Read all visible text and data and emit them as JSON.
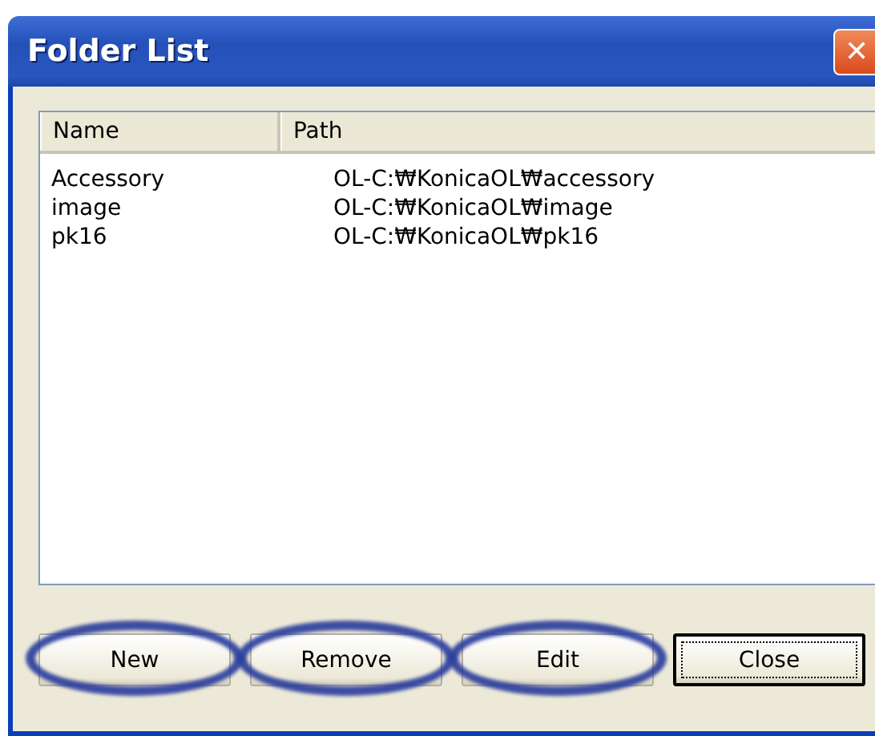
{
  "window": {
    "title": "Folder List",
    "close_glyph": "✕"
  },
  "list": {
    "columns": [
      "Name",
      "Path"
    ],
    "rows": [
      {
        "name": "Accessory",
        "path": "OL-C:₩KonicaOL₩accessory"
      },
      {
        "name": "image",
        "path": "OL-C:₩KonicaOL₩image"
      },
      {
        "name": "pk16",
        "path": "OL-C:₩KonicaOL₩pk16"
      }
    ]
  },
  "buttons": [
    {
      "label": "New",
      "default": false,
      "highlighted": true
    },
    {
      "label": "Remove",
      "default": false,
      "highlighted": true
    },
    {
      "label": "Edit",
      "default": false,
      "highlighted": true
    },
    {
      "label": "Close",
      "default": true,
      "highlighted": false
    }
  ]
}
